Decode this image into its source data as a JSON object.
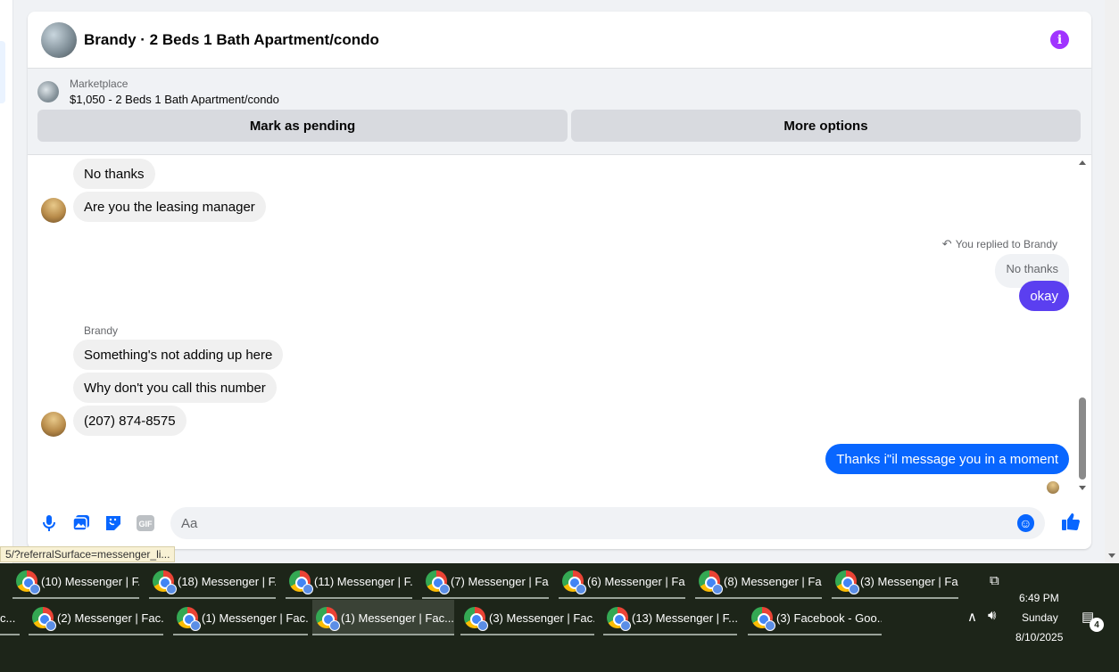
{
  "header": {
    "title": "Brandy · 2 Beds 1 Bath Apartment/condo",
    "info_icon": "info-icon",
    "info_color": "#a033ff"
  },
  "marketplace": {
    "kicker": "Marketplace",
    "listing": "$1,050 - 2 Beds 1 Bath Apartment/condo",
    "mark_pending_label": "Mark as pending",
    "more_options_label": "More options"
  },
  "messages": {
    "m1": "No thanks",
    "m2": "Are you the leasing manager",
    "replied_label": "You replied to Brandy",
    "quoted": "No thanks",
    "m3": "okay",
    "sender": "Brandy",
    "m4": "Something's not adding up here",
    "m5": "Why don't you call this number",
    "m6": "(207) 874-8575",
    "m7": "Thanks i\"il message you in a moment"
  },
  "composer": {
    "placeholder": "Aa",
    "gif_label": "GIF",
    "accent": "#0866ff"
  },
  "status_url": "5/?referralSurface=messenger_li...",
  "taskbar": {
    "row1": [
      "(10) Messenger | F...",
      "(18) Messenger | F...",
      "(11) Messenger | F...",
      "(7) Messenger | Fa...",
      "(6) Messenger | Fa...",
      "(8) Messenger | Fa...",
      "(3) Messenger | Fa..."
    ],
    "row2_partial": "c...",
    "row2": [
      "(2) Messenger | Fac...",
      "(1) Messenger | Fac...",
      "(1) Messenger | Fac...",
      "(3) Messenger | Fac...",
      "(13) Messenger | F...",
      "(3) Facebook - Goo..."
    ],
    "time": "6:49 PM",
    "day": "Sunday",
    "date": "8/10/2025",
    "notification_count": "4"
  }
}
